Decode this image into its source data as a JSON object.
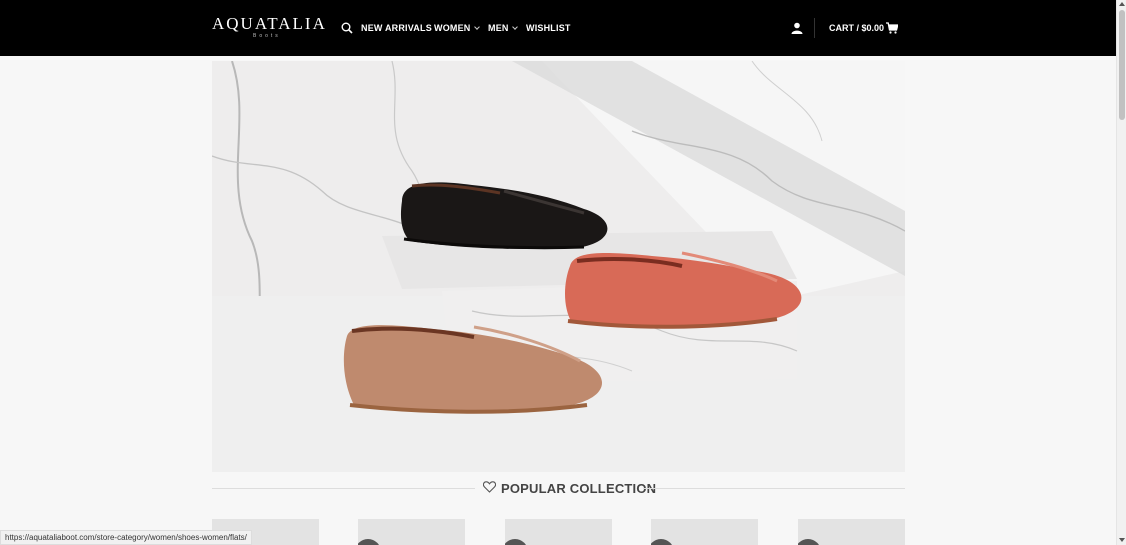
{
  "header": {
    "logo": "AQUATALIA",
    "logo_sub": "Boots",
    "nav": [
      {
        "label": "NEW ARRIVALS"
      },
      {
        "label": "WOMEN"
      },
      {
        "label": "MEN"
      },
      {
        "label": "WISHLIST"
      }
    ],
    "cart_label": "CART / $0.00"
  },
  "hero": {
    "subject": "three suede loafers (black, coral, tan) on white marble"
  },
  "section": {
    "title": "POPULAR COLLECTION"
  },
  "status_bar": {
    "url": "https://aquataliaboot.com/store-category/women/shoes-women/flats/"
  },
  "colors": {
    "header_bg": "#000000",
    "accent_text": "#ffffff"
  }
}
